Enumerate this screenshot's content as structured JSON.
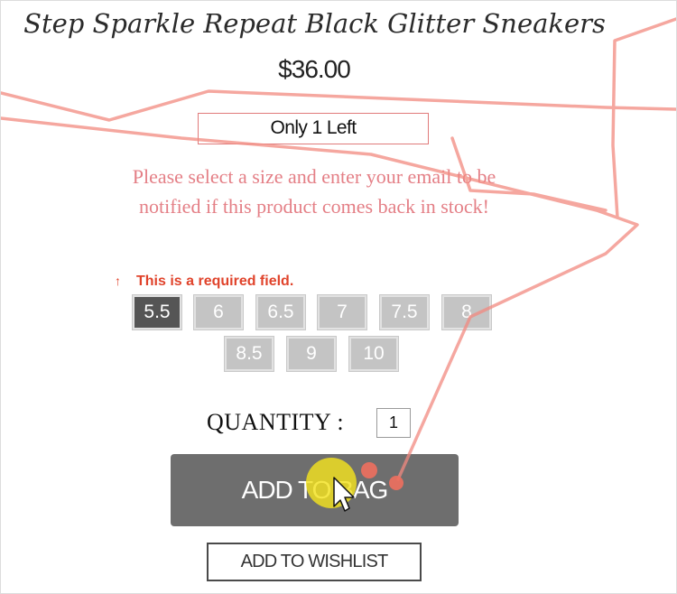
{
  "product": {
    "title": "Step Sparkle Repeat Black Glitter Sneakers",
    "price": "$36.00",
    "stock_label": "Only 1 Left",
    "notify_text": "Please select a size and enter your email to be notified if this product comes back in stock!"
  },
  "size_selector": {
    "required_icon": "↑",
    "required_message": "This is a required field.",
    "sizes": [
      "5.5",
      "6",
      "6.5",
      "7",
      "7.5",
      "8",
      "8.5",
      "9",
      "10"
    ],
    "selected": "5.5"
  },
  "quantity": {
    "label": "QUANTITY :",
    "value": "1"
  },
  "actions": {
    "add_to_bag_label": "ADD TO BAG",
    "wishlist_label": "ADD TO WISHLIST"
  },
  "colors": {
    "selected_size": "#555555",
    "unselected_size": "#c4c4c4",
    "add_to_bag_bg": "#6e6e6e",
    "notify_text": "#e47f86",
    "required_text": "#e0432b",
    "trail": "#f28a80",
    "cursor_highlight": "#f3e21e"
  }
}
